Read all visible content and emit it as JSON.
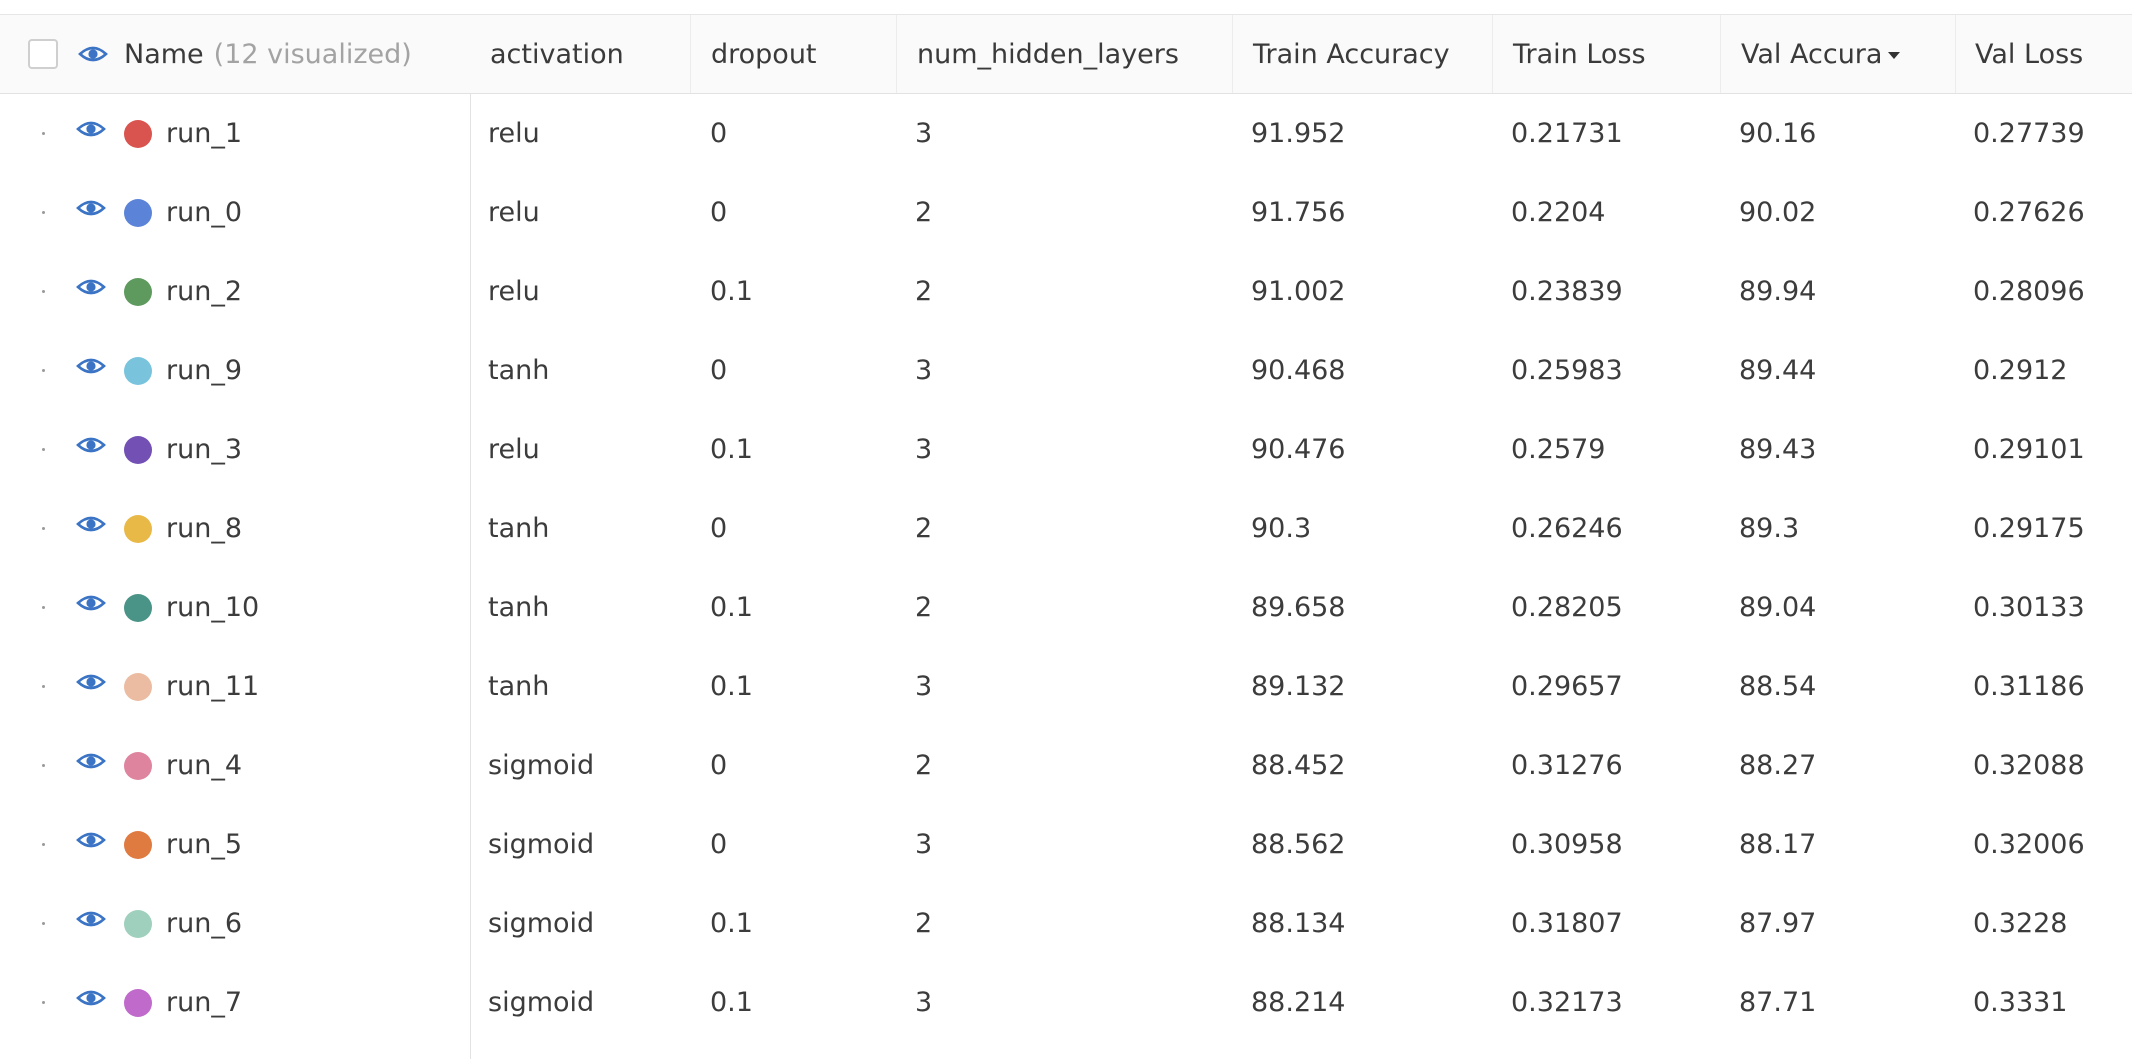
{
  "header": {
    "name_label": "Name",
    "name_count": "(12 visualized)",
    "columns": [
      "activation",
      "dropout",
      "num_hidden_layers",
      "Train Accuracy",
      "Train Loss",
      "Val Accura",
      "Val Loss"
    ],
    "sorted_column": "Val Accura",
    "sort_direction": "descending"
  },
  "rows": [
    {
      "name": "run_1",
      "color": "#d9534f",
      "activation": "relu",
      "dropout": "0",
      "num_hidden_layers": "3",
      "train_accuracy": "91.952",
      "train_loss": "0.21731",
      "val_accuracy": "90.16",
      "val_loss": "0.27739"
    },
    {
      "name": "run_0",
      "color": "#5b84d8",
      "activation": "relu",
      "dropout": "0",
      "num_hidden_layers": "2",
      "train_accuracy": "91.756",
      "train_loss": "0.2204",
      "val_accuracy": "90.02",
      "val_loss": "0.27626"
    },
    {
      "name": "run_2",
      "color": "#5e9a5e",
      "activation": "relu",
      "dropout": "0.1",
      "num_hidden_layers": "2",
      "train_accuracy": "91.002",
      "train_loss": "0.23839",
      "val_accuracy": "89.94",
      "val_loss": "0.28096"
    },
    {
      "name": "run_9",
      "color": "#79c4dc",
      "activation": "tanh",
      "dropout": "0",
      "num_hidden_layers": "3",
      "train_accuracy": "90.468",
      "train_loss": "0.25983",
      "val_accuracy": "89.44",
      "val_loss": "0.2912"
    },
    {
      "name": "run_3",
      "color": "#7350b4",
      "activation": "relu",
      "dropout": "0.1",
      "num_hidden_layers": "3",
      "train_accuracy": "90.476",
      "train_loss": "0.2579",
      "val_accuracy": "89.43",
      "val_loss": "0.29101"
    },
    {
      "name": "run_8",
      "color": "#e9b948",
      "activation": "tanh",
      "dropout": "0",
      "num_hidden_layers": "2",
      "train_accuracy": "90.3",
      "train_loss": "0.26246",
      "val_accuracy": "89.3",
      "val_loss": "0.29175"
    },
    {
      "name": "run_10",
      "color": "#4a9487",
      "activation": "tanh",
      "dropout": "0.1",
      "num_hidden_layers": "2",
      "train_accuracy": "89.658",
      "train_loss": "0.28205",
      "val_accuracy": "89.04",
      "val_loss": "0.30133"
    },
    {
      "name": "run_11",
      "color": "#ebbca1",
      "activation": "tanh",
      "dropout": "0.1",
      "num_hidden_layers": "3",
      "train_accuracy": "89.132",
      "train_loss": "0.29657",
      "val_accuracy": "88.54",
      "val_loss": "0.31186"
    },
    {
      "name": "run_4",
      "color": "#de849f",
      "activation": "sigmoid",
      "dropout": "0",
      "num_hidden_layers": "2",
      "train_accuracy": "88.452",
      "train_loss": "0.31276",
      "val_accuracy": "88.27",
      "val_loss": "0.32088"
    },
    {
      "name": "run_5",
      "color": "#df7a41",
      "activation": "sigmoid",
      "dropout": "0",
      "num_hidden_layers": "3",
      "train_accuracy": "88.562",
      "train_loss": "0.30958",
      "val_accuracy": "88.17",
      "val_loss": "0.32006"
    },
    {
      "name": "run_6",
      "color": "#9ed0bd",
      "activation": "sigmoid",
      "dropout": "0.1",
      "num_hidden_layers": "2",
      "train_accuracy": "88.134",
      "train_loss": "0.31807",
      "val_accuracy": "87.97",
      "val_loss": "0.3228"
    },
    {
      "name": "run_7",
      "color": "#c06bcb",
      "activation": "sigmoid",
      "dropout": "0.1",
      "num_hidden_layers": "3",
      "train_accuracy": "88.214",
      "train_loss": "0.32173",
      "val_accuracy": "87.71",
      "val_loss": "0.3331"
    }
  ],
  "icons": {
    "visibility": "eye-icon",
    "select_all": "checkbox",
    "drag_handle": "drag-handle-icon",
    "sort": "sort-descending-icon"
  },
  "colors": {
    "eye_icon": "#3b74c4",
    "header_background": "#fafafa",
    "border": "#e2e2e2"
  }
}
